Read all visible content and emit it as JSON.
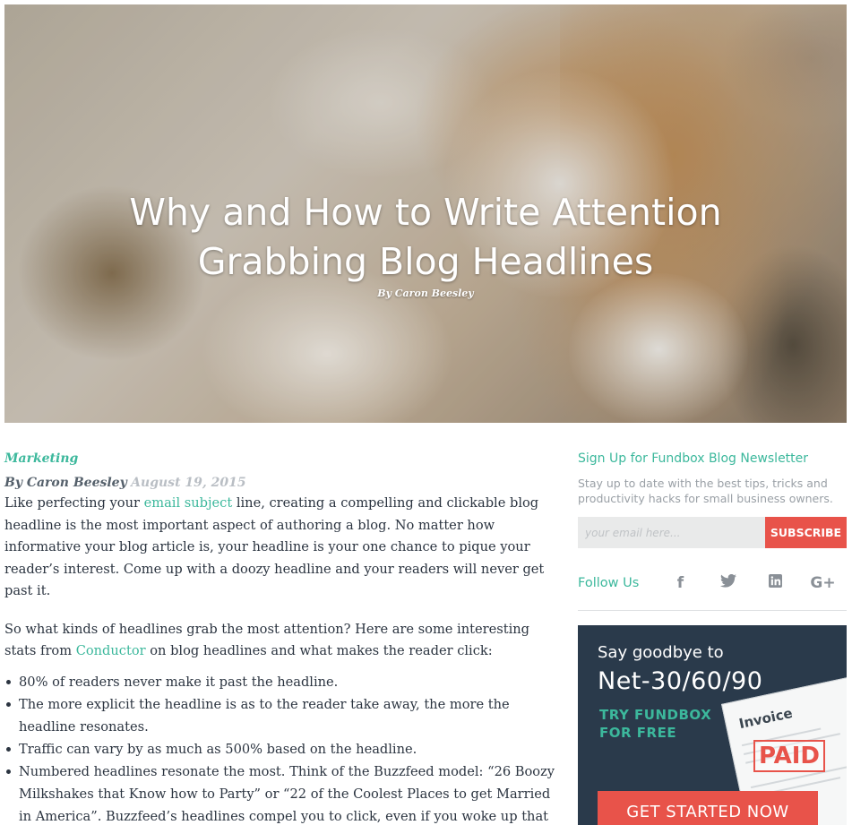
{
  "hero": {
    "title_line1": "Why and How to Write Attention",
    "title_line2": "Grabbing Blog Headlines",
    "author": "By Caron Beesley"
  },
  "article": {
    "category": "Marketing",
    "byline_author": "By Caron Beesley",
    "byline_date": "August 19, 2015",
    "p1": {
      "before": "Like perfecting your ",
      "link": "email subject",
      "after": " line, creating a compelling and clickable blog headline is the most important aspect of authoring a blog. No matter how informative your blog article is, your headline is your one chance to pique your reader’s interest. Come up with a doozy headline and your readers will never get past it."
    },
    "p2": {
      "before": "So what kinds of headlines grab the most attention? Here are some interesting stats from ",
      "link": "Conductor",
      "after": " on blog headlines and what makes the reader click:"
    },
    "bullets": [
      "80% of readers never make it past the headline.",
      "The more explicit the headline is as to the reader take away, the more the headline resonates.",
      "Traffic can vary by as much as 500% based on the headline.",
      "Numbered headlines resonate the most. Think of the Buzzfeed model: “26 Boozy Milkshakes that Know how to Party” or “22 of the Coolest Places to get Married in America”. Buzzfeed’s headlines compel you to click, even if you woke up that morning"
    ]
  },
  "sidebar": {
    "newsletter_title": "Sign Up for Fundbox Blog Newsletter",
    "newsletter_desc": "Stay up to date with the best tips, tricks and productivity hacks for small business owners.",
    "email_placeholder": "your email here...",
    "subscribe_label": "SUBSCRIBE",
    "follow_label": "Follow Us",
    "social": [
      {
        "name": "facebook-icon",
        "glyph": "f"
      },
      {
        "name": "twitter-icon",
        "glyph": "🐦"
      },
      {
        "name": "linkedin-icon",
        "glyph": "in"
      },
      {
        "name": "googleplus-icon",
        "glyph": "G+"
      }
    ]
  },
  "ad": {
    "line1": "Say goodbye to",
    "line2": "Net-30/60/90",
    "cta_line1": "TRY FUNDBOX",
    "cta_line2": "FOR FREE",
    "invoice_label": "Invoice",
    "stamp": "PAID",
    "button": "GET STARTED NOW"
  },
  "colors": {
    "accent": "#3cb89c",
    "button": "#e8534a",
    "ad_bg": "#2a3a4b"
  }
}
